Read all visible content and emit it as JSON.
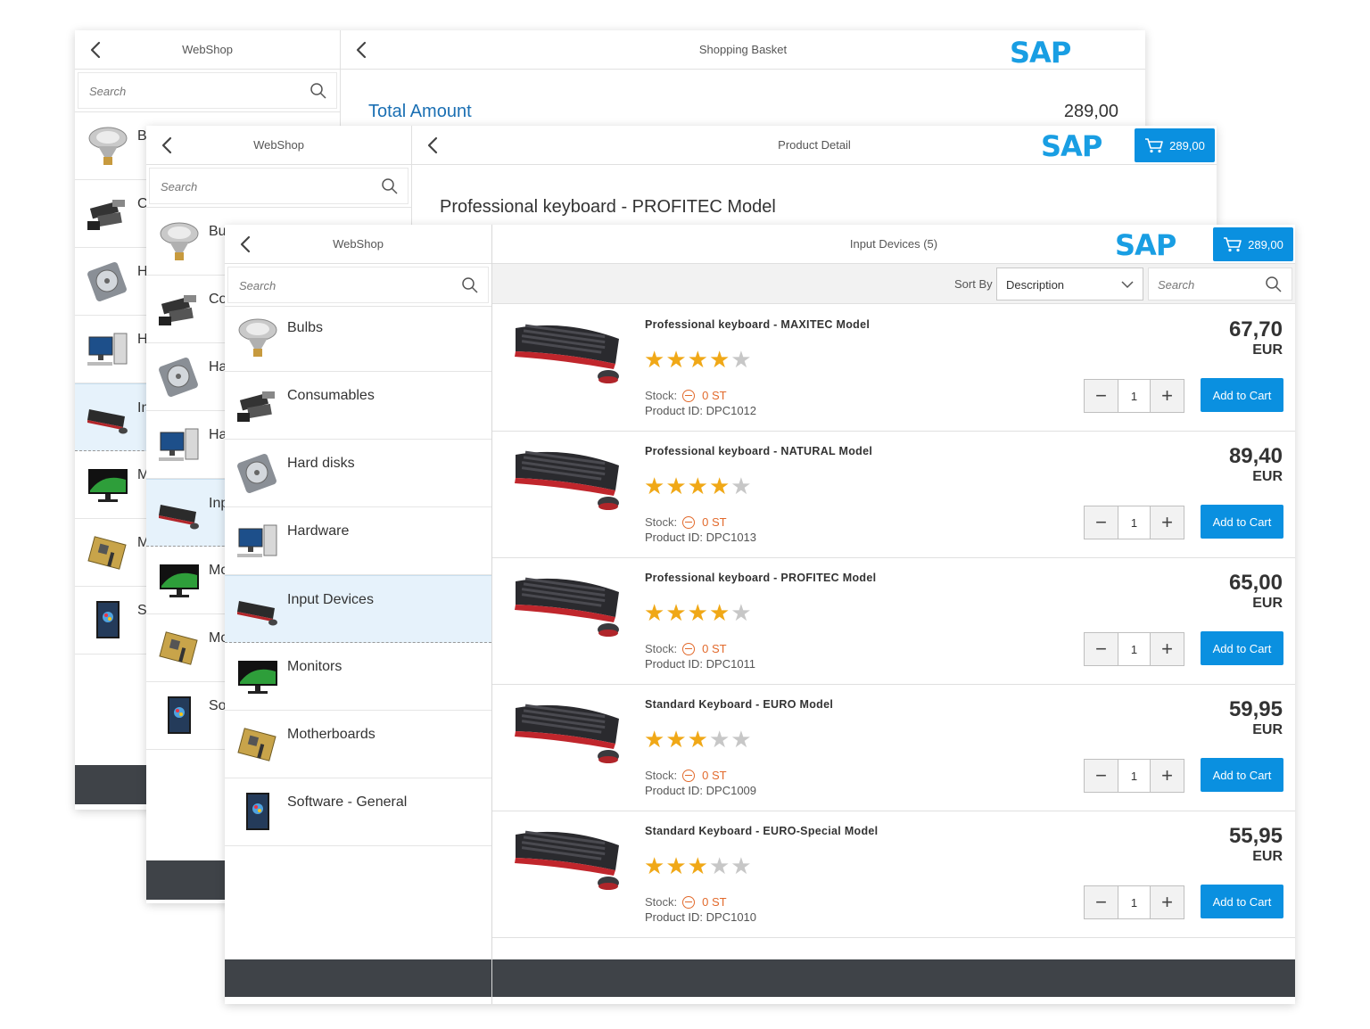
{
  "colors": {
    "accent": "#0a90e0",
    "sap_blue": "#199ee3",
    "footer": "#3f4348",
    "selected_bg": "#e6f2fb",
    "stock_red": "#e26a2c",
    "star": "#f0a817"
  },
  "layer1": {
    "master_title": "WebShop",
    "search_placeholder": "Search",
    "categories": [
      "B",
      "C",
      "H",
      "H",
      "In",
      "M",
      "M",
      "S"
    ],
    "detail_title": "Shopping Basket",
    "logo": "SAP",
    "total_label": "Total Amount",
    "total_value": "289,00"
  },
  "layer2": {
    "master_title": "WebShop",
    "search_placeholder": "Search",
    "categories": [
      "Bu",
      "Co",
      "Ha",
      "Ha",
      "Inp",
      "Mo",
      "Mo",
      "So"
    ],
    "detail_title": "Product Detail",
    "logo": "SAP",
    "cart_total": "289,00",
    "product_name": "Professional keyboard - PROFITEC Model"
  },
  "layer3": {
    "master_title": "WebShop",
    "search_placeholder": "Search",
    "categories": [
      "Bulbs",
      "Consumables",
      "Hard disks",
      "Hardware",
      "Input Devices",
      "Monitors",
      "Motherboards",
      "Software - General"
    ],
    "detail_title": "Input Devices (5)",
    "logo": "SAP",
    "cart_total": "289,00",
    "sort_label": "Sort By",
    "sort_value": "Description",
    "list_search_placeholder": "Search",
    "stock_label": "Stock:",
    "add_to_cart": "Add to Cart",
    "products": [
      {
        "name": "Professional keyboard - MAXITEC Model",
        "rating": 4,
        "stock": "0 ST",
        "product_id": "Product ID: DPC1012",
        "price": "67,70",
        "currency": "EUR",
        "qty": "1"
      },
      {
        "name": "Professional keyboard - NATURAL Model",
        "rating": 4,
        "stock": "0 ST",
        "product_id": "Product ID: DPC1013",
        "price": "89,40",
        "currency": "EUR",
        "qty": "1"
      },
      {
        "name": "Professional keyboard - PROFITEC Model",
        "rating": 4,
        "stock": "0 ST",
        "product_id": "Product ID: DPC1011",
        "price": "65,00",
        "currency": "EUR",
        "qty": "1"
      },
      {
        "name": "Standard Keyboard - EURO Model",
        "rating": 3,
        "stock": "0 ST",
        "product_id": "Product ID: DPC1009",
        "price": "59,95",
        "currency": "EUR",
        "qty": "1"
      },
      {
        "name": "Standard Keyboard - EURO-Special Model",
        "rating": 3,
        "stock": "0 ST",
        "product_id": "Product ID: DPC1010",
        "price": "55,95",
        "currency": "EUR",
        "qty": "1"
      }
    ]
  }
}
